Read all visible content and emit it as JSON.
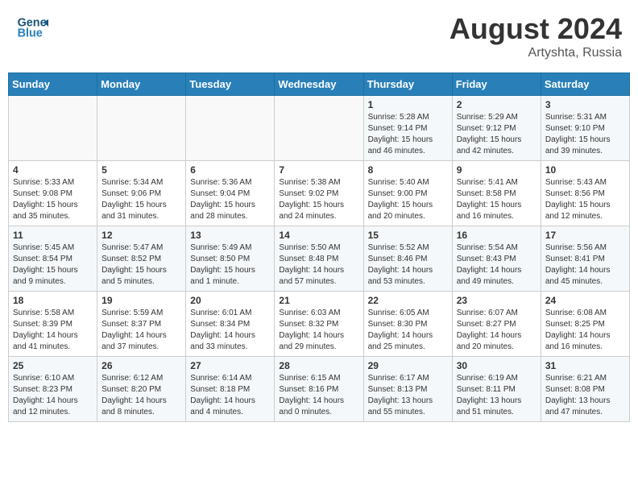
{
  "header": {
    "logo_line1": "General",
    "logo_line2": "Blue",
    "month_year": "August 2024",
    "location": "Artyshta, Russia"
  },
  "weekdays": [
    "Sunday",
    "Monday",
    "Tuesday",
    "Wednesday",
    "Thursday",
    "Friday",
    "Saturday"
  ],
  "weeks": [
    [
      {
        "day": "",
        "sunrise": "",
        "sunset": "",
        "daylight": ""
      },
      {
        "day": "",
        "sunrise": "",
        "sunset": "",
        "daylight": ""
      },
      {
        "day": "",
        "sunrise": "",
        "sunset": "",
        "daylight": ""
      },
      {
        "day": "",
        "sunrise": "",
        "sunset": "",
        "daylight": ""
      },
      {
        "day": "1",
        "sunrise": "5:28 AM",
        "sunset": "9:14 PM",
        "daylight": "15 hours and 46 minutes."
      },
      {
        "day": "2",
        "sunrise": "5:29 AM",
        "sunset": "9:12 PM",
        "daylight": "15 hours and 42 minutes."
      },
      {
        "day": "3",
        "sunrise": "5:31 AM",
        "sunset": "9:10 PM",
        "daylight": "15 hours and 39 minutes."
      }
    ],
    [
      {
        "day": "4",
        "sunrise": "5:33 AM",
        "sunset": "9:08 PM",
        "daylight": "15 hours and 35 minutes."
      },
      {
        "day": "5",
        "sunrise": "5:34 AM",
        "sunset": "9:06 PM",
        "daylight": "15 hours and 31 minutes."
      },
      {
        "day": "6",
        "sunrise": "5:36 AM",
        "sunset": "9:04 PM",
        "daylight": "15 hours and 28 minutes."
      },
      {
        "day": "7",
        "sunrise": "5:38 AM",
        "sunset": "9:02 PM",
        "daylight": "15 hours and 24 minutes."
      },
      {
        "day": "8",
        "sunrise": "5:40 AM",
        "sunset": "9:00 PM",
        "daylight": "15 hours and 20 minutes."
      },
      {
        "day": "9",
        "sunrise": "5:41 AM",
        "sunset": "8:58 PM",
        "daylight": "15 hours and 16 minutes."
      },
      {
        "day": "10",
        "sunrise": "5:43 AM",
        "sunset": "8:56 PM",
        "daylight": "15 hours and 12 minutes."
      }
    ],
    [
      {
        "day": "11",
        "sunrise": "5:45 AM",
        "sunset": "8:54 PM",
        "daylight": "15 hours and 9 minutes."
      },
      {
        "day": "12",
        "sunrise": "5:47 AM",
        "sunset": "8:52 PM",
        "daylight": "15 hours and 5 minutes."
      },
      {
        "day": "13",
        "sunrise": "5:49 AM",
        "sunset": "8:50 PM",
        "daylight": "15 hours and 1 minute."
      },
      {
        "day": "14",
        "sunrise": "5:50 AM",
        "sunset": "8:48 PM",
        "daylight": "14 hours and 57 minutes."
      },
      {
        "day": "15",
        "sunrise": "5:52 AM",
        "sunset": "8:46 PM",
        "daylight": "14 hours and 53 minutes."
      },
      {
        "day": "16",
        "sunrise": "5:54 AM",
        "sunset": "8:43 PM",
        "daylight": "14 hours and 49 minutes."
      },
      {
        "day": "17",
        "sunrise": "5:56 AM",
        "sunset": "8:41 PM",
        "daylight": "14 hours and 45 minutes."
      }
    ],
    [
      {
        "day": "18",
        "sunrise": "5:58 AM",
        "sunset": "8:39 PM",
        "daylight": "14 hours and 41 minutes."
      },
      {
        "day": "19",
        "sunrise": "5:59 AM",
        "sunset": "8:37 PM",
        "daylight": "14 hours and 37 minutes."
      },
      {
        "day": "20",
        "sunrise": "6:01 AM",
        "sunset": "8:34 PM",
        "daylight": "14 hours and 33 minutes."
      },
      {
        "day": "21",
        "sunrise": "6:03 AM",
        "sunset": "8:32 PM",
        "daylight": "14 hours and 29 minutes."
      },
      {
        "day": "22",
        "sunrise": "6:05 AM",
        "sunset": "8:30 PM",
        "daylight": "14 hours and 25 minutes."
      },
      {
        "day": "23",
        "sunrise": "6:07 AM",
        "sunset": "8:27 PM",
        "daylight": "14 hours and 20 minutes."
      },
      {
        "day": "24",
        "sunrise": "6:08 AM",
        "sunset": "8:25 PM",
        "daylight": "14 hours and 16 minutes."
      }
    ],
    [
      {
        "day": "25",
        "sunrise": "6:10 AM",
        "sunset": "8:23 PM",
        "daylight": "14 hours and 12 minutes."
      },
      {
        "day": "26",
        "sunrise": "6:12 AM",
        "sunset": "8:20 PM",
        "daylight": "14 hours and 8 minutes."
      },
      {
        "day": "27",
        "sunrise": "6:14 AM",
        "sunset": "8:18 PM",
        "daylight": "14 hours and 4 minutes."
      },
      {
        "day": "28",
        "sunrise": "6:15 AM",
        "sunset": "8:16 PM",
        "daylight": "14 hours and 0 minutes."
      },
      {
        "day": "29",
        "sunrise": "6:17 AM",
        "sunset": "8:13 PM",
        "daylight": "13 hours and 55 minutes."
      },
      {
        "day": "30",
        "sunrise": "6:19 AM",
        "sunset": "8:11 PM",
        "daylight": "13 hours and 51 minutes."
      },
      {
        "day": "31",
        "sunrise": "6:21 AM",
        "sunset": "8:08 PM",
        "daylight": "13 hours and 47 minutes."
      }
    ]
  ],
  "labels": {
    "sunrise": "Sunrise:",
    "sunset": "Sunset:",
    "daylight": "Daylight:"
  }
}
